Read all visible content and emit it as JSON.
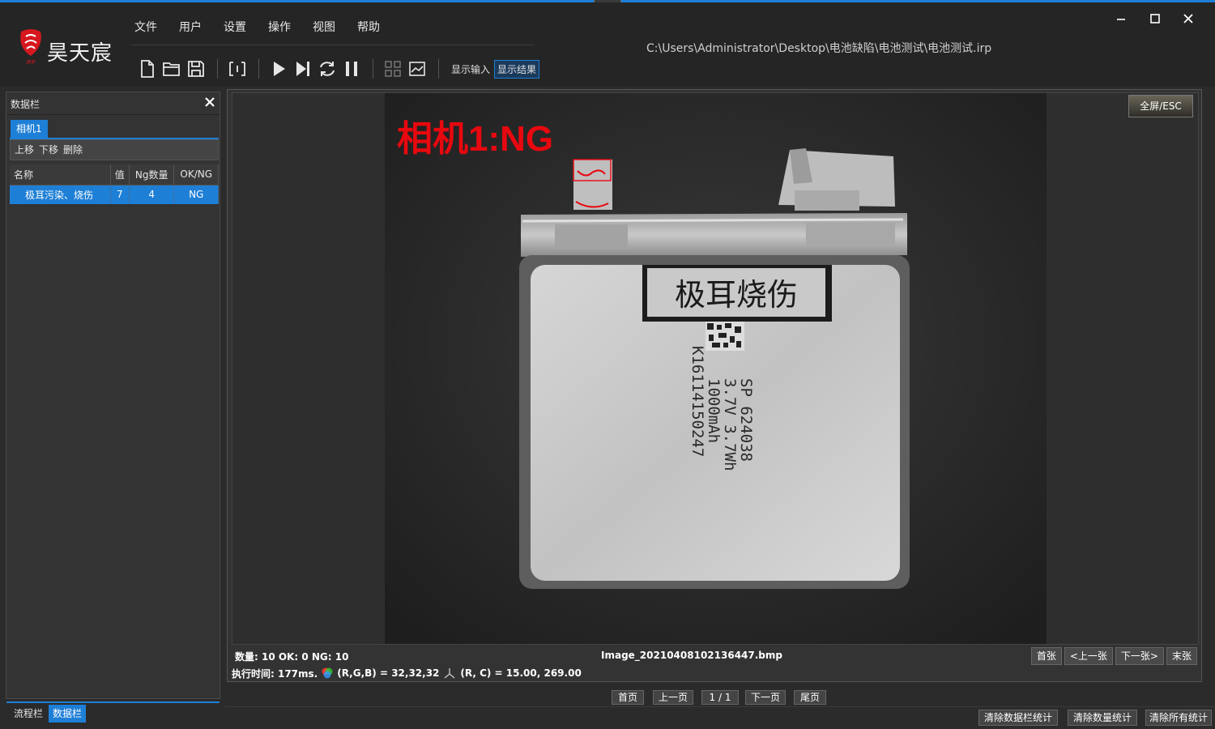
{
  "window": {
    "brand": "昊天宸",
    "file_path": "C:\\Users\\Administrator\\Desktop\\电池缺陷\\电池测试\\电池测试.irp"
  },
  "menu": [
    "文件",
    "用户",
    "设置",
    "操作",
    "视图",
    "帮助"
  ],
  "toolbar": {
    "show_input": "显示输入",
    "show_result": "显示结果",
    "icons": [
      "new-file-icon",
      "open-folder-icon",
      "save-icon",
      "frame-icon",
      "play-icon",
      "step-icon",
      "loop-icon",
      "pause-icon",
      "grid-icon",
      "image-icon"
    ]
  },
  "data_panel": {
    "title": "数据栏",
    "camera_tab": "相机1",
    "actions": [
      "上移",
      "下移",
      "删除"
    ],
    "columns": [
      "名称",
      "值",
      "Ng数量",
      "OK/NG"
    ],
    "rows": [
      {
        "name": "极耳污染、烧伤",
        "value": "7",
        "ng_count": "4",
        "result": "NG"
      }
    ],
    "bottom_tabs": [
      "流程栏",
      "数据栏"
    ]
  },
  "viewer": {
    "overlay_label": "相机1:NG",
    "fullscreen": "全屏/ESC",
    "photo_label": "极耳烧伤",
    "stats": "数量: 10 OK: 0 NG: 10",
    "filename": "Image_20210408102136447.bmp",
    "nav": [
      "首张",
      "<上一张",
      "下一张>",
      "末张"
    ],
    "exec_time": "执行时间: 177ms.",
    "rgb": "(R,G,B) = 32,32,32",
    "rc": "(R, C) = 15.00, 269.00"
  },
  "pager": {
    "first": "首页",
    "prev": "上一页",
    "indicator": "1 / 1",
    "next": "下一页",
    "last": "尾页"
  },
  "footer": {
    "clear_panel_stats": "清除数据栏统计",
    "clear_count_stats": "清除数量统计",
    "clear_all_stats": "清除所有统计"
  },
  "colors": {
    "accent": "#1e7fd6",
    "ng_red": "#e8080f",
    "background": "#2b2b2b"
  }
}
